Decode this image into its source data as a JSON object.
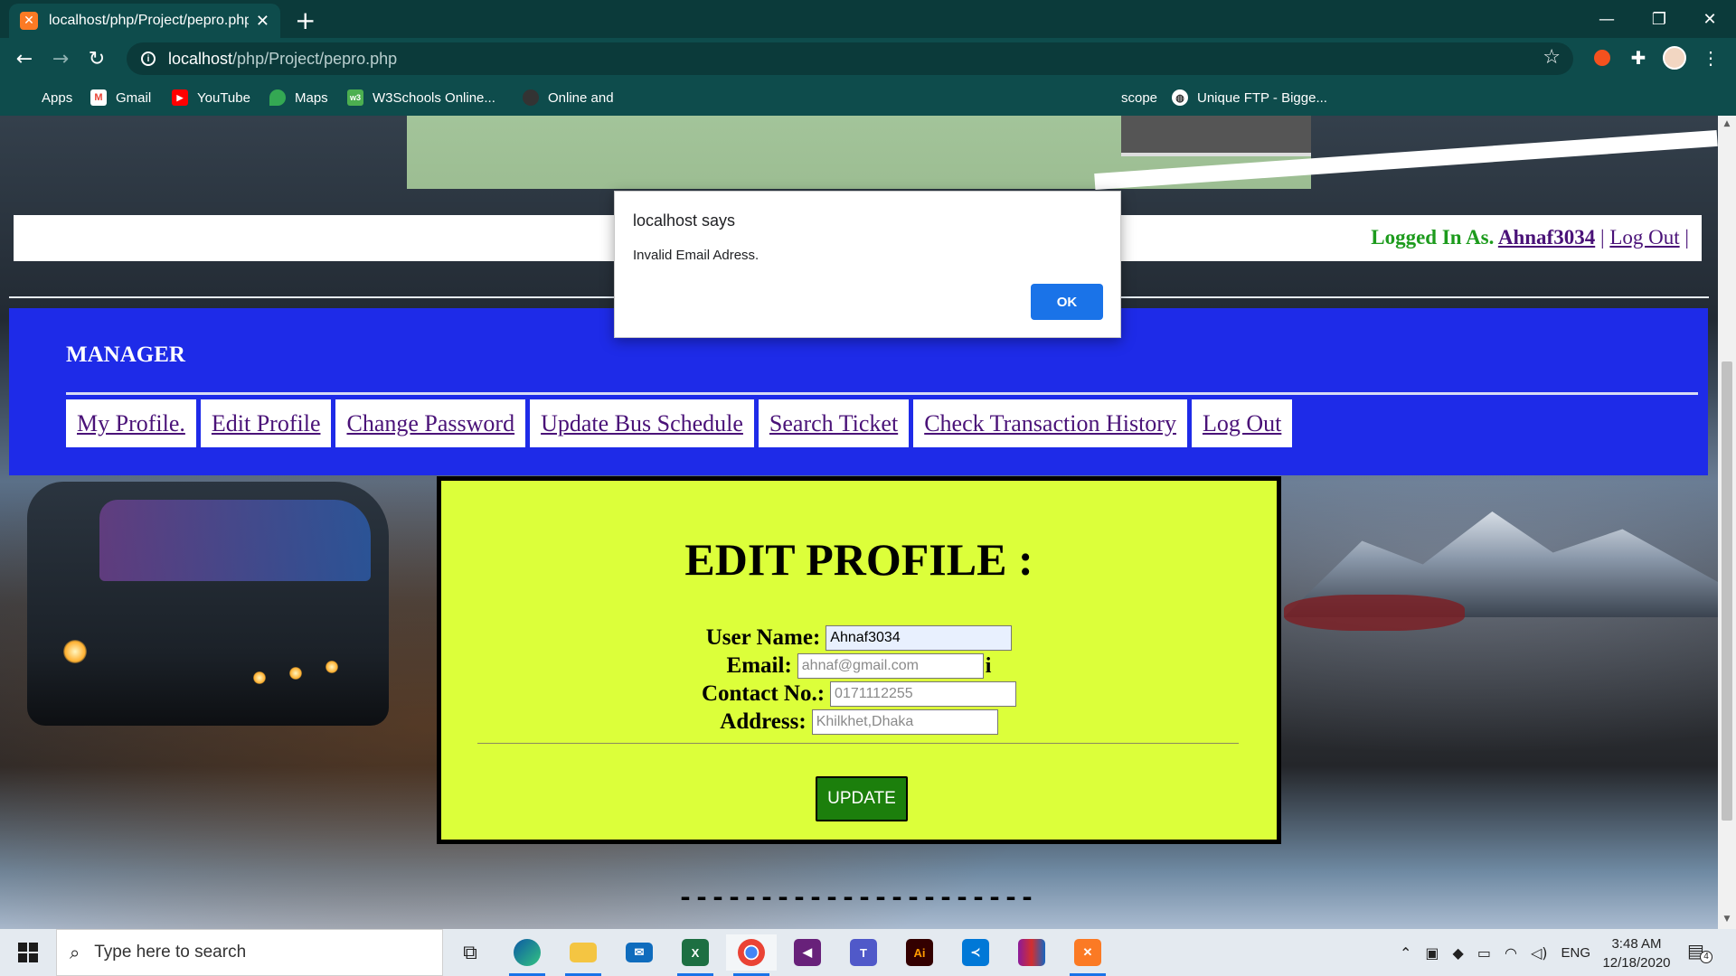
{
  "browser": {
    "tab_title": "localhost/php/Project/pepro.php",
    "tab_favicon": "xampp-icon",
    "url_host": "localhost",
    "url_path": "/php/Project/pepro.php",
    "bookmarks": [
      {
        "label": "Apps",
        "icon": "apps-grid-icon"
      },
      {
        "label": "Gmail",
        "icon": "gmail-icon"
      },
      {
        "label": "YouTube",
        "icon": "youtube-icon"
      },
      {
        "label": "Maps",
        "icon": "maps-icon"
      },
      {
        "label": "W3Schools Online...",
        "icon": "w3schools-icon"
      },
      {
        "label": "Online and",
        "icon": "github-icon"
      },
      {
        "label": "scope",
        "icon": "none"
      },
      {
        "label": "Unique FTP - Bigge...",
        "icon": "globe-icon"
      }
    ]
  },
  "alert": {
    "title": "localhost says",
    "message": "Invalid Email Adress.",
    "ok_label": "OK"
  },
  "login_bar": {
    "prefix": "Logged In As.",
    "username": "Ahnaf3034",
    "separator1": "|",
    "logout": "Log Out",
    "separator2": "|"
  },
  "manager": {
    "title": "MANAGER",
    "menu": [
      "My Profile.",
      "Edit Profile",
      "Change Password",
      "Update Bus Schedule",
      "Search Ticket",
      "Check Transaction History",
      "Log Out"
    ]
  },
  "edit_profile": {
    "title": "EDIT PROFILE :",
    "username_label": "User Name:",
    "username_value": "Ahnaf3034",
    "email_label": "Email:",
    "email_placeholder": "ahnaf@gmail.com",
    "email_suffix": "i",
    "contact_label": "Contact No.:",
    "contact_placeholder": "0171112255",
    "address_label": "Address:",
    "address_placeholder": "Khilkhet,Dhaka",
    "update_label": "UPDATE"
  },
  "footer_dashes": "-----------------------",
  "taskbar": {
    "search_placeholder": "Type here to search",
    "apps": [
      "task-view-icon",
      "edge-icon",
      "file-explorer-icon",
      "mail-icon",
      "excel-icon",
      "chrome-icon",
      "visual-studio-icon",
      "teams-icon",
      "illustrator-icon",
      "vscode-icon",
      "winrar-icon",
      "xampp-icon"
    ],
    "language": "ENG",
    "time": "3:48 AM",
    "date": "12/18/2020",
    "notification_count": "4"
  }
}
